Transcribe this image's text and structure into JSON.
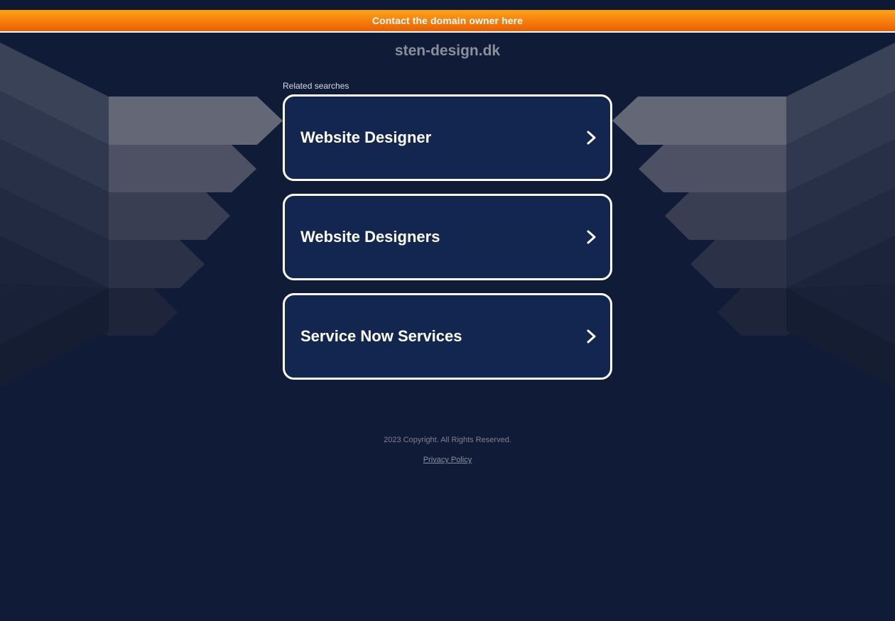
{
  "contact_bar": {
    "label": "Contact the domain owner here"
  },
  "domain": {
    "name": "sten-design.dk"
  },
  "related": {
    "label": "Related searches",
    "items": [
      {
        "label": "Website Designer"
      },
      {
        "label": "Website Designers"
      },
      {
        "label": "Service Now Services"
      }
    ]
  },
  "footer": {
    "copyright": "2023 Copyright. All Rights Reserved.",
    "privacy_label": "Privacy Policy"
  },
  "colors": {
    "background": "#101b37",
    "card_fill": "#13264f",
    "card_border": "#ffffff",
    "contact_gradient_top": "#fba31a",
    "contact_gradient_bottom": "#ea5f03"
  },
  "icons": {
    "card_arrow": "chevron-right-icon"
  }
}
